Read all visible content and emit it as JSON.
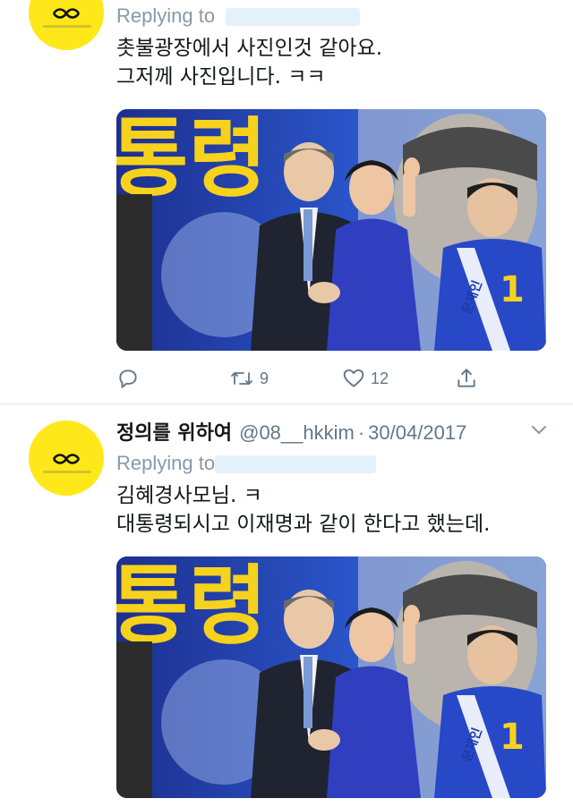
{
  "tweets": [
    {
      "reply_prefix": "Replying to",
      "text_lines": [
        "촛불광장에서 사진인것 같아요.",
        "그저께 사진입니다. ㅋㅋ"
      ],
      "photo": {
        "banner_text": "통령",
        "badge_number": "1",
        "sash_text": "문재인",
        "sash_sub": "더불어민주당"
      },
      "actions": {
        "reply_icon": "reply-icon",
        "retweet_icon": "retweet-icon",
        "retweet_count": "9",
        "like_icon": "heart-icon",
        "like_count": "12",
        "share_icon": "share-icon"
      }
    },
    {
      "display_name": "정의를 위하여",
      "handle": "@08__hkkim",
      "separator": "·",
      "date": "30/04/2017",
      "reply_prefix": "Replying to",
      "text_lines": [
        "김혜경사모님. ㅋ",
        "대통령되시고 이재명과 같이 한다고 했는데."
      ],
      "photo": {
        "banner_text": "통령",
        "badge_number": "1",
        "sash_text": "문재인",
        "sash_sub": "더불어민주당"
      }
    }
  ],
  "colors": {
    "avatar_bg": "#ffe81a",
    "muted": "#657786",
    "photo_blue": "#2a44b8",
    "banner_yellow": "#f7d21c"
  }
}
